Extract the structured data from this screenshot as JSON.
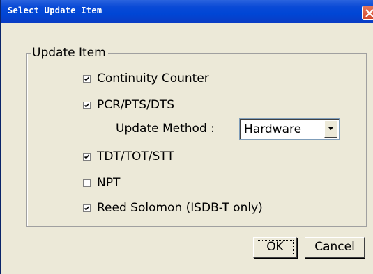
{
  "window": {
    "title": "Select Update Item"
  },
  "group": {
    "label": "Update Item"
  },
  "items": [
    {
      "label": "Continuity Counter",
      "checked": true
    },
    {
      "label": "PCR/PTS/DTS",
      "checked": true
    },
    {
      "label": "TDT/TOT/STT",
      "checked": true
    },
    {
      "label": "NPT",
      "checked": false
    },
    {
      "label": "Reed Solomon (ISDB-T only)",
      "checked": true
    }
  ],
  "update_method": {
    "label": "Update Method :",
    "selected": "Hardware"
  },
  "buttons": {
    "ok": "OK",
    "cancel": "Cancel"
  },
  "colors": {
    "titlebar": "#0a4ad6",
    "dialog_bg": "#ece9d8",
    "close_button": "#d0472c"
  }
}
